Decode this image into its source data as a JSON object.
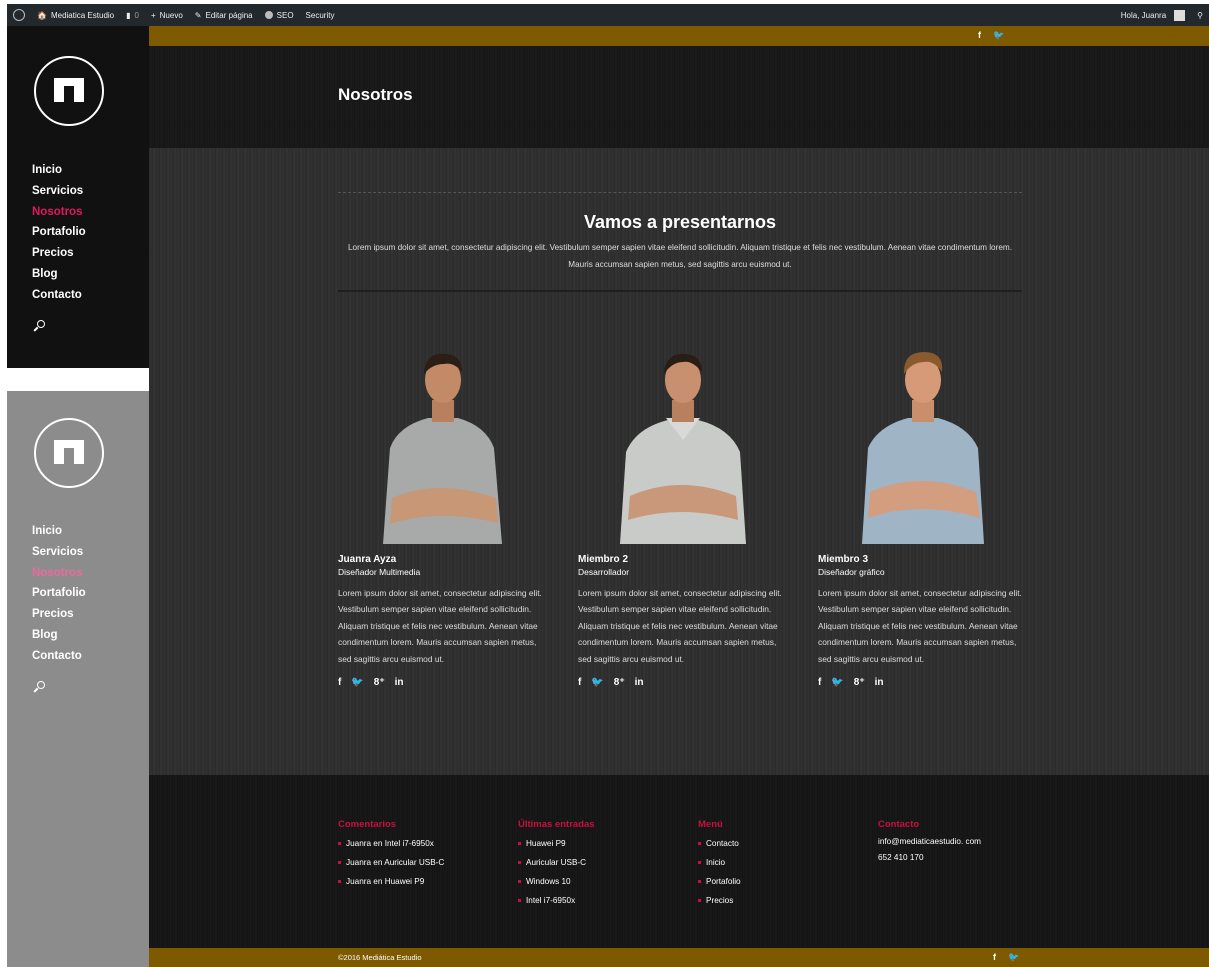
{
  "adminbar": {
    "site_name": "Mediatica Estudio",
    "comments_count": "0",
    "new_label": "Nuevo",
    "edit_label": "Editar página",
    "seo_label": "SEO",
    "security_label": "Security",
    "greeting": "Hola, Juanra"
  },
  "sidebar": {
    "items": [
      {
        "label": "Inicio"
      },
      {
        "label": "Servicios"
      },
      {
        "label": "Nosotros"
      },
      {
        "label": "Portafolio"
      },
      {
        "label": "Precios"
      },
      {
        "label": "Blog"
      },
      {
        "label": "Contacto"
      }
    ],
    "active_index": 2
  },
  "header": {
    "title": "Nosotros"
  },
  "intro": {
    "title": "Vamos a presentarnos",
    "text": "Lorem ipsum dolor sit amet, consectetur adipiscing elit. Vestibulum semper sapien vitae eleifend sollicitudin. Aliquam tristique et felis nec vestibulum. Aenean vitae condimentum lorem. Mauris accumsan sapien metus, sed sagittis arcu euismod ut."
  },
  "team": [
    {
      "name": "Juanra Ayza",
      "role": "Diseñador Multimedia",
      "bio": "Lorem ipsum dolor sit amet, consectetur adipiscing elit. Vestibulum semper sapien vitae eleifend sollicitudin. Aliquam tristique et felis nec vestibulum. Aenean vitae condimentum lorem. Mauris accumsan sapien metus, sed sagittis arcu euismod ut."
    },
    {
      "name": "Miembro 2",
      "role": "Desarrollador",
      "bio": "Lorem ipsum dolor sit amet, consectetur adipiscing elit. Vestibulum semper sapien vitae eleifend sollicitudin. Aliquam tristique et felis nec vestibulum. Aenean vitae condimentum lorem. Mauris accumsan sapien metus, sed sagittis arcu euismod ut."
    },
    {
      "name": "Miembro 3",
      "role": "Diseñador gráfico",
      "bio": "Lorem ipsum dolor sit amet, consectetur adipiscing elit. Vestibulum semper sapien vitae eleifend sollicitudin. Aliquam tristique et felis nec vestibulum. Aenean vitae condimentum lorem. Mauris accumsan sapien metus, sed sagittis arcu euismod ut."
    }
  ],
  "social_glyphs": {
    "facebook": "f",
    "twitter": "🐦",
    "googleplus": "8⁺",
    "linkedin": "in"
  },
  "footer": {
    "comments": {
      "title": "Comentarios",
      "items": [
        "Juanra en Intel i7-6950x",
        "Juanra en Auricular USB-C",
        "Juanra en Huawei P9"
      ]
    },
    "latest": {
      "title": "Últimas entradas",
      "items": [
        "Huawei P9",
        "Auricular USB-C",
        "Windows 10",
        "Intel i7-6950x"
      ]
    },
    "menu": {
      "title": "Menú",
      "items": [
        "Contacto",
        "Inicio",
        "Portafolio",
        "Precios"
      ]
    },
    "contact": {
      "title": "Contacto",
      "email": "info@mediaticaestudio. com",
      "phone": "652 410 170"
    }
  },
  "copyright": "©2016 Mediática Estudio",
  "colors": {
    "accent": "#e0195e",
    "gold_bar": "#7d5a00",
    "footer_heading": "#c8103f"
  },
  "icons": [
    "wordpress-icon",
    "site-icon",
    "comment-icon",
    "plus-icon",
    "pencil-icon",
    "seo-dot-icon",
    "facebook-icon",
    "twitter-icon",
    "googleplus-icon",
    "linkedin-icon",
    "search-icon",
    "logo-icon"
  ]
}
